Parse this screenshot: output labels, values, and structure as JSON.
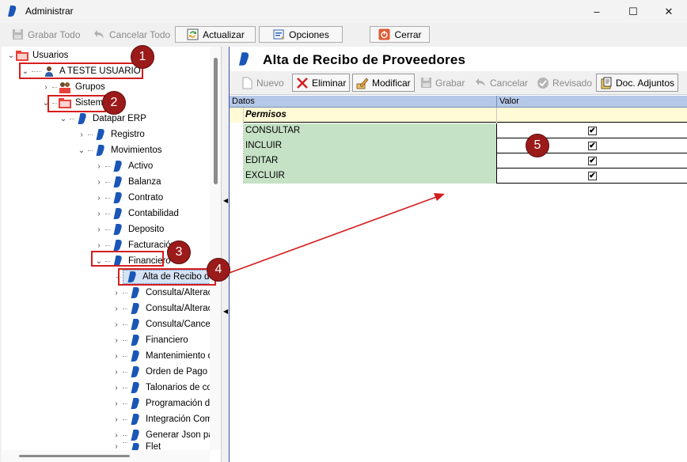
{
  "window": {
    "title": "Administrar",
    "controls": {
      "minimize": "–",
      "maximize": "☐",
      "close": "✕"
    }
  },
  "toolbar": {
    "grabar_todo": "Grabar Todo",
    "cancelar_todo": "Cancelar Todo",
    "actualizar": "Actualizar",
    "opciones": "Opciones",
    "cerrar": "Cerrar"
  },
  "tree": {
    "usuarios": "Usuarios",
    "user": "A TESTE USUARIO",
    "grupos": "Grupos",
    "sistemas": "Sistemas",
    "datapar": "Datapar ERP",
    "registro": "Registro",
    "movimientos": "Movimientos",
    "activo": "Activo",
    "balanza": "Balanza",
    "contrato": "Contrato",
    "contabilidad": "Contabilidad",
    "deposito": "Deposito",
    "facturacion": "Facturación",
    "financiero": "Financiero",
    "alta_recibo": "Alta de Recibo d",
    "fin_children": [
      "Consulta/Alterac",
      "Consulta/Alterac",
      "Consulta/Cancel",
      "Financiero",
      "Mantenimiento d",
      "Orden de Pago \\",
      "Talonarios de co",
      "Programación de",
      "Integración Comp",
      "Generar Json pa"
    ],
    "last_partial": "Flet"
  },
  "panel": {
    "title": "Alta de Recibo de Proveedores",
    "toolbar": {
      "nuevo": "Nuevo",
      "eliminar": "Eliminar",
      "modificar": "Modificar",
      "grabar": "Grabar",
      "cancelar": "Cancelar",
      "revisado": "Revisado",
      "doc_adjuntos": "Doc. Adjuntos"
    },
    "grid": {
      "col_datos": "Datos",
      "col_valor": "Valor",
      "group": "Permisos",
      "rows": [
        {
          "name": "CONSULTAR",
          "checked": "✔"
        },
        {
          "name": "INCLUIR",
          "checked": "✔"
        },
        {
          "name": "EDITAR",
          "checked": "✔"
        },
        {
          "name": "EXCLUIR",
          "checked": "✔"
        }
      ]
    }
  },
  "annotations": {
    "b1": "1",
    "b2": "2",
    "b3": "3",
    "b4": "4",
    "b5": "5"
  },
  "colors": {
    "annotation_red": "#d41e1e",
    "badge": "#9b1a1a",
    "grid_header": "#b5c8e8",
    "group_row": "#fffbd6",
    "perm_row": "#c6e2c6",
    "logo_blue": "#1a56b8"
  }
}
